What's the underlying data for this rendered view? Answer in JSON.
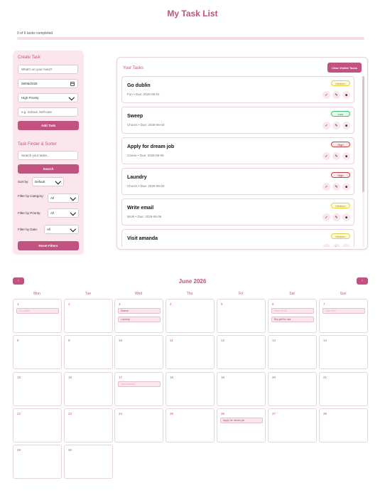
{
  "header": {
    "title": "My Task List",
    "progress_text": "0 of 6 tasks completed",
    "progress_fraction": 0
  },
  "create": {
    "heading": "Create Task",
    "task_placeholder": "What's on your mind?",
    "date_value": "06/06/2026",
    "priority_value": "High Priority",
    "category_placeholder": "e.g. School, Self-care",
    "add_label": "Add Task"
  },
  "finder": {
    "heading": "Task Finder & Sorter",
    "search_placeholder": "Search your tasks...",
    "search_label": "Search",
    "sort_label": "Sort by:",
    "sort_value": "Default",
    "category_label": "Filter by Category:",
    "category_value": "All",
    "priority_label": "Filter by Priority:",
    "priority_value": "All",
    "date_label": "Filter by Date:",
    "date_value": "All",
    "reset_label": "Reset Filters"
  },
  "tasks_panel": {
    "title": "Your Tasks",
    "clear_label": "Clear Visible Tasks",
    "tasks": [
      {
        "title": "Go dublin",
        "meta": "Fun • Due: 2026-06-01",
        "priority": "Medium",
        "level": "medium"
      },
      {
        "title": "Sweep",
        "meta": "Chores • Due: 2026-06-03",
        "priority": "Low",
        "level": "low"
      },
      {
        "title": "Apply for dream job",
        "meta": "Career • Due: 2026-06-05",
        "priority": "High",
        "level": "high"
      },
      {
        "title": "Laundry",
        "meta": "Chores • Due: 2026-06-03",
        "priority": "High",
        "level": "high"
      },
      {
        "title": "Write email",
        "meta": "Work • Due: 2026-06-06",
        "priority": "Medium",
        "level": "medium"
      },
      {
        "title": "Visit amanda",
        "meta": "",
        "priority": "Medium",
        "level": "medium"
      }
    ],
    "icons": {
      "complete": "check-icon",
      "edit": "edit-icon",
      "delete": "trash-icon"
    }
  },
  "calendar": {
    "month_label": "June 2026",
    "prev_label": "‹",
    "next_label": "›",
    "weekdays": [
      "Mon",
      "Tue",
      "Wed",
      "Thu",
      "Fri",
      "Sat",
      "Sun"
    ],
    "days": [
      {
        "day": "1",
        "events": [
          {
            "text": "Go dublin",
            "faded": true
          }
        ]
      },
      {
        "day": "2",
        "events": []
      },
      {
        "day": "3",
        "events": [
          {
            "text": "Sweep",
            "faded": false
          },
          {
            "text": "Laundry",
            "faded": false
          }
        ]
      },
      {
        "day": "4",
        "events": []
      },
      {
        "day": "5",
        "events": []
      },
      {
        "day": "6",
        "events": [
          {
            "text": "Write email",
            "faded": true
          },
          {
            "text": "Buy gift for mia",
            "faded": false
          }
        ]
      },
      {
        "day": "7",
        "events": [
          {
            "text": "Call mom",
            "faded": true
          }
        ]
      },
      {
        "day": "8",
        "events": []
      },
      {
        "day": "9",
        "events": []
      },
      {
        "day": "10",
        "events": []
      },
      {
        "day": "11",
        "events": []
      },
      {
        "day": "12",
        "events": []
      },
      {
        "day": "13",
        "events": []
      },
      {
        "day": "14",
        "events": []
      },
      {
        "day": "15",
        "events": []
      },
      {
        "day": "16",
        "events": []
      },
      {
        "day": "17",
        "events": [
          {
            "text": "Visit amanda",
            "faded": true
          }
        ]
      },
      {
        "day": "18",
        "events": []
      },
      {
        "day": "19",
        "events": []
      },
      {
        "day": "20",
        "events": []
      },
      {
        "day": "21",
        "events": []
      },
      {
        "day": "22",
        "events": []
      },
      {
        "day": "23",
        "events": []
      },
      {
        "day": "24",
        "events": []
      },
      {
        "day": "25",
        "events": []
      },
      {
        "day": "26",
        "events": [
          {
            "text": "Apply for dream job",
            "faded": false
          }
        ]
      },
      {
        "day": "27",
        "events": []
      },
      {
        "day": "28",
        "events": []
      },
      {
        "day": "29",
        "events": []
      },
      {
        "day": "30",
        "events": []
      }
    ]
  },
  "colors": {
    "accent": "#c2527f",
    "panel_bg": "#fbe6ee",
    "progress_track": "#f3dde6"
  }
}
